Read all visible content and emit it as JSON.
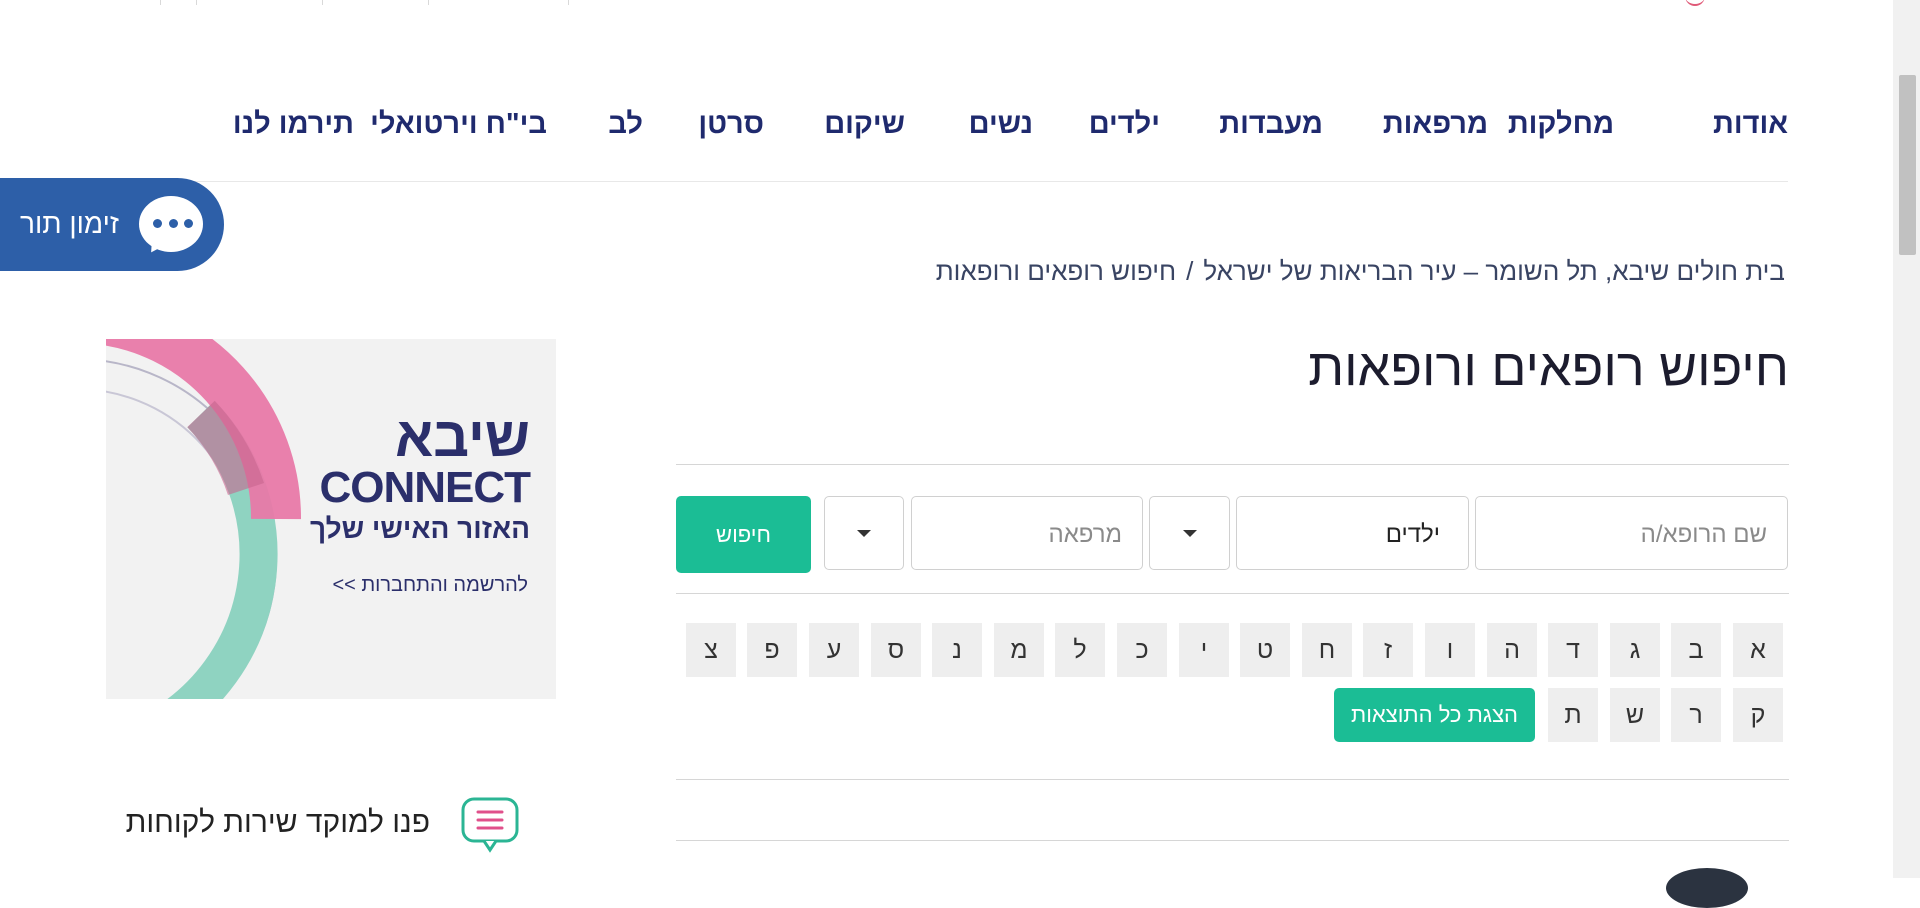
{
  "nav": {
    "items": [
      {
        "label": "אודות"
      },
      {
        "label": "מחלקות"
      },
      {
        "label": "מרפאות"
      },
      {
        "label": "מעבדות"
      },
      {
        "label": "ילדים"
      },
      {
        "label": "נשים"
      },
      {
        "label": "שיקום"
      },
      {
        "label": "סרטן"
      },
      {
        "label": "לב"
      },
      {
        "label": "בי\"ח וירטואלי"
      },
      {
        "label": "תירמו לנו"
      }
    ]
  },
  "appointment": {
    "label": "זימון תור",
    "icon": "chat-bubble-icon",
    "color": "#2d5fa8"
  },
  "breadcrumb": {
    "home": "בית חולים שיבא, תל השומר – עיר הבריאות של ישראל",
    "separator": "/",
    "current": "חיפוש רופאים ורופאות"
  },
  "page": {
    "title": "חיפוש רופאים ורופאות"
  },
  "search": {
    "doctor_placeholder": "שם הרופא/ה",
    "department_value": "ילדים",
    "clinic_placeholder": "מרפאה",
    "button_label": "חיפוש",
    "accent": "#1bbd95"
  },
  "letters": [
    "א",
    "ב",
    "ג",
    "ד",
    "ה",
    "ו",
    "ז",
    "ח",
    "ט",
    "י",
    "כ",
    "ל",
    "מ",
    "נ",
    "ס",
    "ע",
    "פ",
    "צ",
    "ק",
    "ר",
    "ש",
    "ת"
  ],
  "show_all_label": "הצגת כל התוצאות",
  "banner": {
    "title_hebrew": "שיבא",
    "title_english": "CONNECT",
    "subtitle": "האזור האישי שלך",
    "link": "להרשמה והתחברות >>"
  },
  "service": {
    "label": "פנו למוקד שירות לקוחות",
    "icon": "message-icon"
  }
}
